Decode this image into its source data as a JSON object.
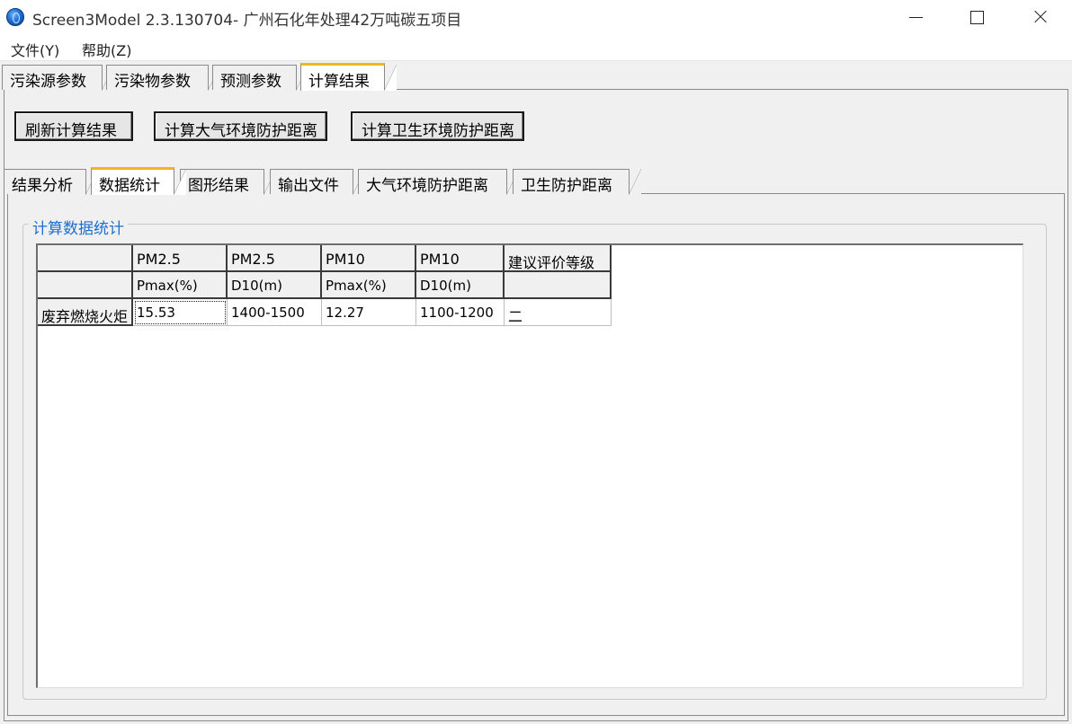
{
  "window": {
    "title": "Screen3Model 2.3.130704- 广州石化年处理42万吨碳五项目"
  },
  "menu": {
    "items": [
      {
        "label": "文件(Y)"
      },
      {
        "label": "帮助(Z)"
      }
    ]
  },
  "top_tabs": [
    {
      "label": "污染源参数"
    },
    {
      "label": "污染物参数"
    },
    {
      "label": "预测参数"
    },
    {
      "label": "计算结果",
      "active": true
    }
  ],
  "buttons": {
    "refresh": "刷新计算结果",
    "calc_air": "计算大气环境防护距离",
    "calc_health": "计算卫生环境防护距离"
  },
  "sub_tabs": [
    {
      "label": "结果分析"
    },
    {
      "label": "数据统计",
      "active": true
    },
    {
      "label": "图形结果"
    },
    {
      "label": "输出文件"
    },
    {
      "label": "大气环境防护距离"
    },
    {
      "label": "卫生防护距离"
    }
  ],
  "group": {
    "title": "计算数据统计"
  },
  "table": {
    "header_row1": [
      "",
      "PM2.5",
      "PM2.5",
      "PM10",
      "PM10",
      "建议评价等级"
    ],
    "header_row2": [
      "",
      "Pmax(%)",
      "D10(m)",
      "Pmax(%)",
      "D10(m)",
      ""
    ],
    "rows": [
      [
        "废弃燃烧火炬",
        "15.53",
        "1400-1500",
        "12.27",
        "1100-1200",
        "二"
      ]
    ]
  },
  "colors": {
    "active_tab_accent": "#f2b51c",
    "group_title": "#1b6fd0"
  }
}
